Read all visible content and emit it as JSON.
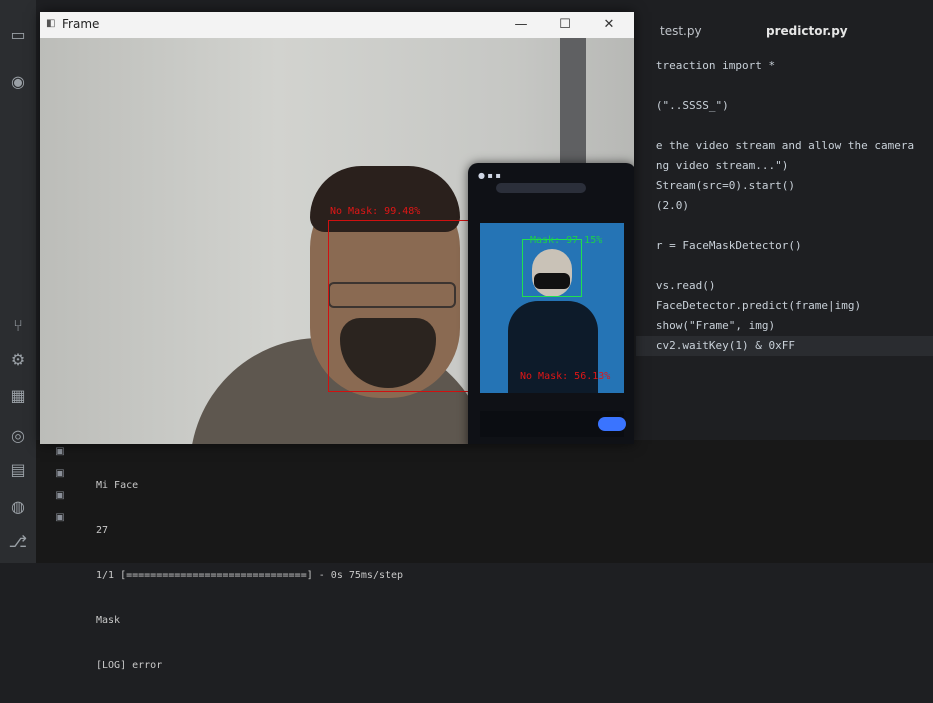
{
  "editor": {
    "tabs": [
      "test.py",
      "predictor.py"
    ],
    "code_lines": [
      "   treaction import *",
      "",
      "   (\"..SSSS_\")",
      "",
      "   e the video stream and allow the camera",
      "   ng video stream...\")",
      "   Stream(src=0).start()",
      "   (2.0)",
      "",
      "   r = FaceMaskDetector()",
      "",
      "   vs.read()",
      "   FaceDetector.predict(frame|img)",
      "   show(\"Frame\", img)",
      "   cv2.waitKey(1) & 0xFF"
    ]
  },
  "terminal": {
    "lines": [
      "Mi Face",
      "27",
      "1/1 [==============================] - 0s 75ms/step",
      "Mask",
      "[LOG] error"
    ]
  },
  "window": {
    "title": "Frame",
    "controls": [
      "—",
      "☐",
      "✕"
    ],
    "detections": [
      {
        "label": "No Mask: 99.48%"
      },
      {
        "label": "Mask: 97.15%"
      },
      {
        "label": "No Mask: 56.13%"
      }
    ]
  }
}
